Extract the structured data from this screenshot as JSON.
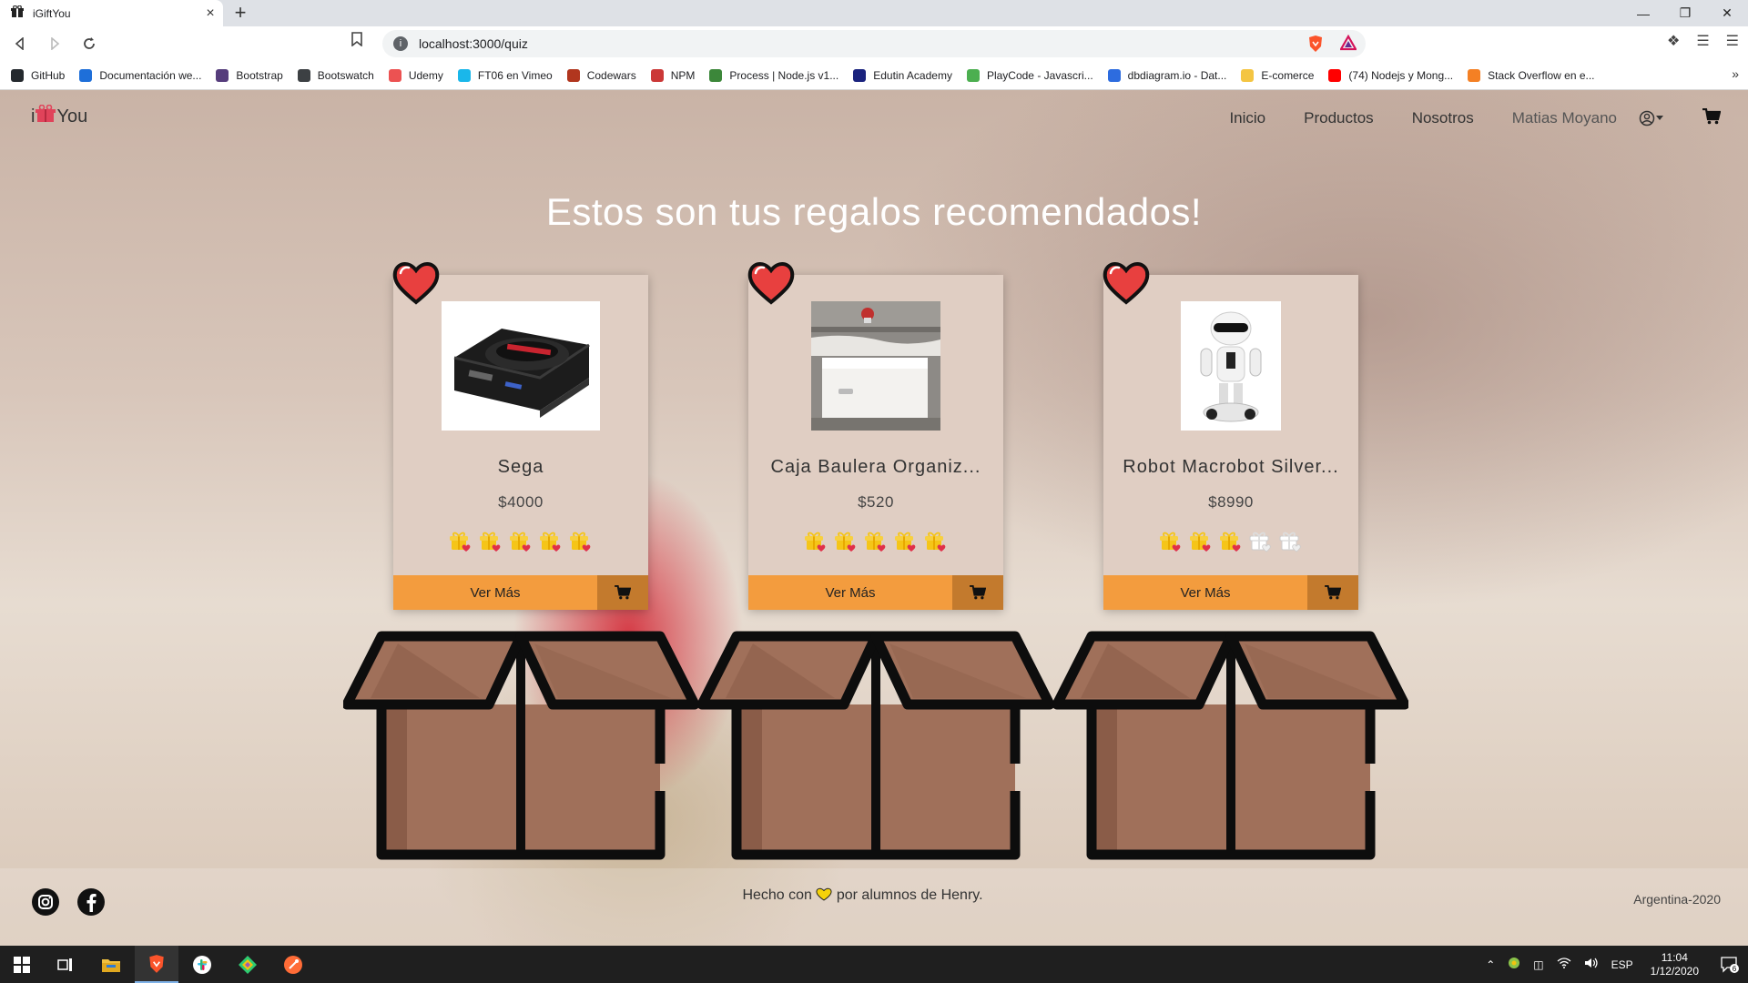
{
  "browser": {
    "tab_title": "iGiftYou",
    "tab_close": "×",
    "new_tab": "+",
    "url": "localhost:3000/quiz",
    "bookmarks": [
      {
        "label": "GitHub",
        "color": "#24292e"
      },
      {
        "label": "Documentación we...",
        "color": "#1e6fd9"
      },
      {
        "label": "Bootstrap",
        "color": "#563d7c"
      },
      {
        "label": "Bootswatch",
        "color": "#3c4043"
      },
      {
        "label": "Udemy",
        "color": "#ec5252"
      },
      {
        "label": "FT06 en Vimeo",
        "color": "#1ab7ea"
      },
      {
        "label": "Codewars",
        "color": "#b1361e"
      },
      {
        "label": "NPM",
        "color": "#cb3837"
      },
      {
        "label": "Process | Node.js v1...",
        "color": "#3c873a"
      },
      {
        "label": "Edutin Academy",
        "color": "#1a237e"
      },
      {
        "label": "PlayCode - Javascri...",
        "color": "#4caf50"
      },
      {
        "label": "dbdiagram.io - Dat...",
        "color": "#2d6cdf"
      },
      {
        "label": "E-comerce",
        "color": "#f4c542"
      },
      {
        "label": "(74) Nodejs y Mong...",
        "color": "#ff0000"
      },
      {
        "label": "Stack Overflow en e...",
        "color": "#f48024"
      }
    ]
  },
  "site": {
    "logo": {
      "prefix": "i",
      "suffix": "You"
    },
    "nav": {
      "inicio": "Inicio",
      "productos": "Productos",
      "nosotros": "Nosotros",
      "user": "Matias Moyano"
    },
    "title": "Estos son tus regalos recomendados!",
    "products": [
      {
        "name": "Sega",
        "price": "$4000",
        "rating": 5,
        "button": "Ver Más"
      },
      {
        "name": "Caja Baulera Organiz...",
        "price": "$520",
        "rating": 5,
        "button": "Ver Más"
      },
      {
        "name": "Robot Macrobot Silver...",
        "price": "$8990",
        "rating": 3,
        "button": "Ver Más"
      }
    ],
    "footer": {
      "text_before": "Hecho con",
      "text_after": "por alumnos de Henry.",
      "right": "Argentina-2020"
    }
  },
  "taskbar": {
    "lang": "ESP",
    "time": "11:04",
    "date": "1/12/2020",
    "notifications": "6"
  },
  "colors": {
    "accent_orange": "#f39c3e",
    "cart_button": "#c37a2d",
    "card_bg": "#e0cec3",
    "box_brown": "#a0705a"
  }
}
